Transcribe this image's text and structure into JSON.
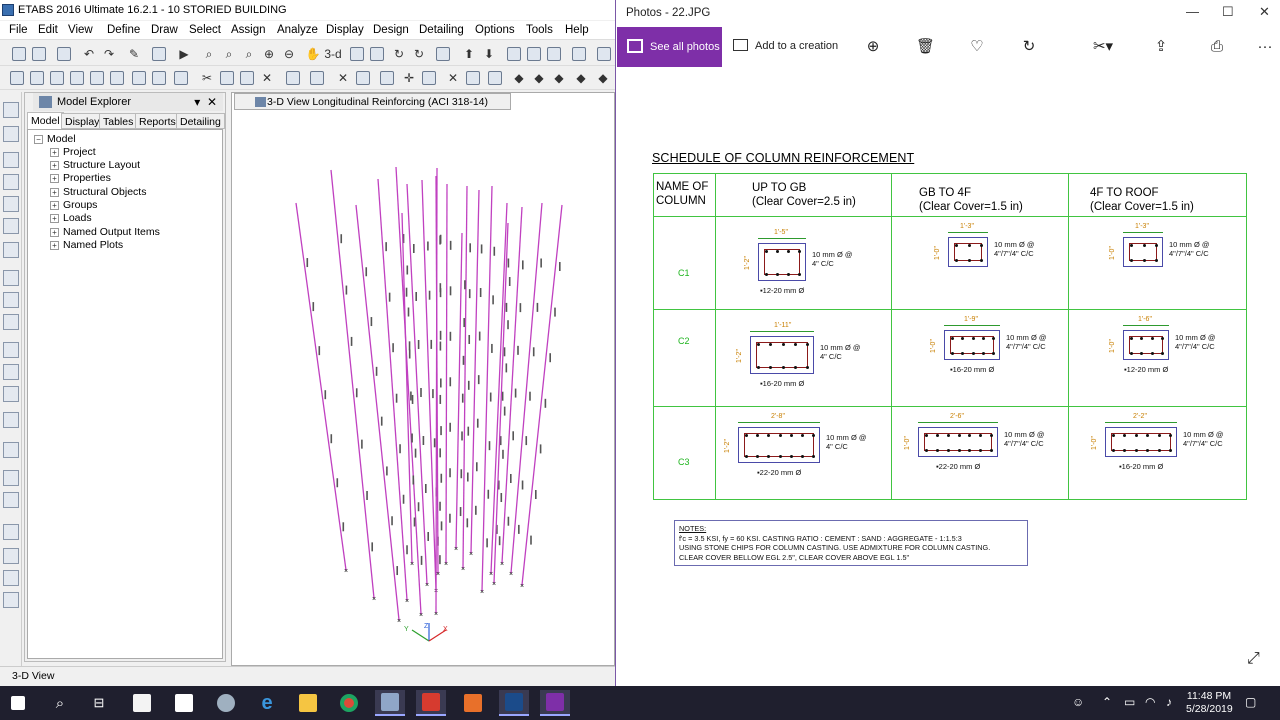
{
  "etabs": {
    "title": "ETABS 2016 Ultimate 16.2.1 - 10 STORIED BUILDING",
    "menu": [
      "File",
      "Edit",
      "View",
      "Define",
      "Draw",
      "Select",
      "Assign",
      "Analyze",
      "Display",
      "Design",
      "Detailing",
      "Options",
      "Tools",
      "Help"
    ],
    "explorer": {
      "title": "Model Explorer",
      "tabs": [
        "Model",
        "Display",
        "Tables",
        "Reports",
        "Detailing"
      ],
      "root": "Model",
      "items": [
        "Project",
        "Structure Layout",
        "Properties",
        "Structural Objects",
        "Groups",
        "Loads",
        "Named Output Items",
        "Named Plots"
      ]
    },
    "view_tab": "3-D View  Longitudinal Reinforcing  (ACI 318-14)",
    "status": "3-D View",
    "axis_labels": {
      "x": "X",
      "y": "Y",
      "z": "Z"
    }
  },
  "photos": {
    "title": "Photos - 22.JPG",
    "see_all": "See all photos",
    "add_creation": "Add to a creation",
    "more": "···",
    "doc": {
      "title": "SCHEDULE OF COLUMN REINFORCEMENT",
      "headers": {
        "name": "NAME OF COLUMN",
        "up_to_gb": "UP TO GB",
        "up_to_gb_cover": "(Clear Cover=2.5 in)",
        "gb_to_4f": "GB TO 4F",
        "gb_to_4f_cover": "(Clear Cover=1.5 in)",
        "4f_to_roof": "4F TO ROOF",
        "4f_to_roof_cover": "(Clear Cover=1.5 in)"
      },
      "rows": [
        {
          "name": "C1",
          "cells": [
            {
              "w": "1'-5\"",
              "h": "1'-2\"",
              "tie": "10 mm Ø @ 4\" C/C",
              "bars": "12-20 mm Ø"
            },
            {
              "w": "1'-3\"",
              "h": "1'-0\"",
              "tie": "10 mm Ø @ 4\"/7\"/4\" C/C",
              "bars": ""
            },
            {
              "w": "1'-3\"",
              "h": "1'-0\"",
              "tie": "10 mm Ø @ 4\"/7\"/4\" C/C",
              "bars": ""
            }
          ]
        },
        {
          "name": "C2",
          "cells": [
            {
              "w": "1'-11\"",
              "h": "1'-2\"",
              "tie": "10 mm Ø @ 4\" C/C",
              "bars": "16-20 mm Ø"
            },
            {
              "w": "1'-9\"",
              "h": "1'-0\"",
              "tie": "10 mm Ø @ 4\"/7\"/4\" C/C",
              "bars": "16-20 mm Ø"
            },
            {
              "w": "1'-6\"",
              "h": "1'-0\"",
              "tie": "10 mm Ø @ 4\"/7\"/4\" C/C",
              "bars": "12-20 mm Ø"
            }
          ]
        },
        {
          "name": "C3",
          "cells": [
            {
              "w": "2'-8\"",
              "h": "1'-2\"",
              "tie": "10 mm Ø @ 4\" C/C",
              "bars": "22-20 mm Ø"
            },
            {
              "w": "2'-6\"",
              "h": "1'-0\"",
              "tie": "10 mm Ø @ 4\"/7\"/4\" C/C",
              "bars": "22-20 mm Ø"
            },
            {
              "w": "2'-2\"",
              "h": "1'-0\"",
              "tie": "10 mm Ø @ 4\"/7\"/4\" C/C",
              "bars": "16-20 mm Ø"
            }
          ]
        }
      ],
      "notes": [
        "NOTES:",
        "f'c = 3.5 KSI, fy = 60 KSI. CASTING RATIO : CEMENT : SAND : AGGREGATE - 1:1.5:3",
        "USING STONE CHIPS FOR COLUMN CASTING. USE ADMIXTURE FOR COLUMN CASTING.",
        "CLEAR COVER BELLOW EGL 2.5\",  CLEAR COVER ABOVE EGL 1.5\""
      ]
    }
  },
  "taskbar": {
    "time": "11:48 PM",
    "date": "5/28/2019"
  },
  "colors": {
    "accent": "#7e2fa8",
    "grid": "#41c441",
    "column": "#c040c0"
  }
}
